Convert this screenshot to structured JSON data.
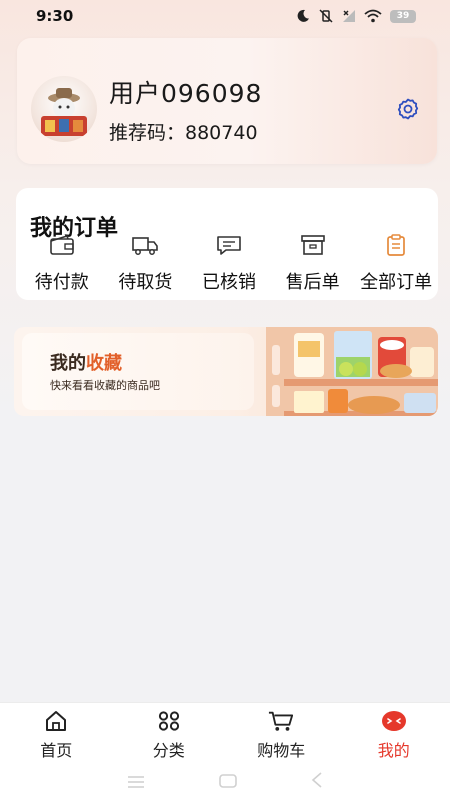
{
  "status_bar": {
    "time": "9:30",
    "battery": "39",
    "icons": [
      "moon-icon",
      "vibrate-off-icon",
      "no-signal-icon",
      "wifi-icon",
      "battery-icon"
    ]
  },
  "profile": {
    "username": "用户096098",
    "referral_code": "推荐码：880740",
    "settings_icon": "gear-icon"
  },
  "orders": {
    "title": "我的订单",
    "items": [
      {
        "label": "待付款",
        "icon": "wallet-icon"
      },
      {
        "label": "待取货",
        "icon": "truck-icon"
      },
      {
        "label": "已核销",
        "icon": "message-icon"
      },
      {
        "label": "售后单",
        "icon": "archive-box-icon"
      },
      {
        "label": "全部订单",
        "icon": "clipboard-icon"
      }
    ],
    "accent_color": "#e58a3c"
  },
  "favorites": {
    "title_prefix": "我的",
    "title_accent": "收藏",
    "subtitle": "快来看看收藏的商品吧",
    "accent_color": "#e2602a"
  },
  "tab_bar": {
    "items": [
      {
        "label": "首页",
        "icon": "home-icon",
        "active": false
      },
      {
        "label": "分类",
        "icon": "grid-icon",
        "active": false
      },
      {
        "label": "购物车",
        "icon": "cart-icon",
        "active": false
      },
      {
        "label": "我的",
        "icon": "profile-face-icon",
        "active": true
      }
    ],
    "active_color": "#e5382b"
  },
  "system_nav": {
    "icons": [
      "menu-icon",
      "home-square-icon",
      "back-icon"
    ]
  }
}
